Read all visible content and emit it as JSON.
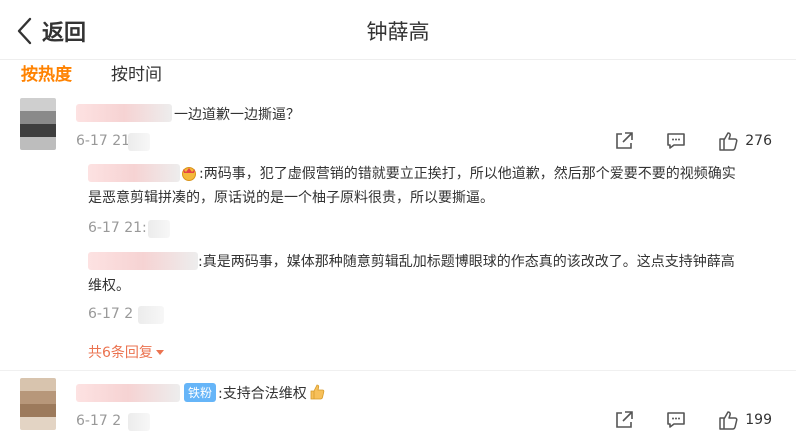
{
  "header": {
    "back_label": "返回",
    "title": "钟薛高"
  },
  "tabs": [
    {
      "label": "按热度",
      "active": true
    },
    {
      "label": "按时间",
      "active": false
    }
  ],
  "comments": [
    {
      "text": "一边道歉一边撕逼？",
      "time": "6-17 21",
      "likes": "276",
      "replies": [
        {
          "text": ":两码事，犯了虚假营销的错就要立正挨打，所以他道歉，然后那个爱要不要的视频确实",
          "text2": "是恶意剪辑拼凑的，原话说的是一个柚子原料很贵，所以要撕逼。",
          "time": "6-17 21:"
        },
        {
          "text": ":真是两码事，媒体那种随意剪辑乱加标题博眼球的作态真的该改改了。这点支持钟薛高",
          "text2": "维权。",
          "time": "6-17 2"
        }
      ],
      "more_label": "共6条回复"
    },
    {
      "badge": "铁粉",
      "text": ":支持合法维权",
      "time": "6-17 2",
      "likes": "199"
    }
  ],
  "colors": {
    "accent": "#ff8200",
    "reply_link": "#eb7350",
    "badge": "#66b5f8"
  }
}
